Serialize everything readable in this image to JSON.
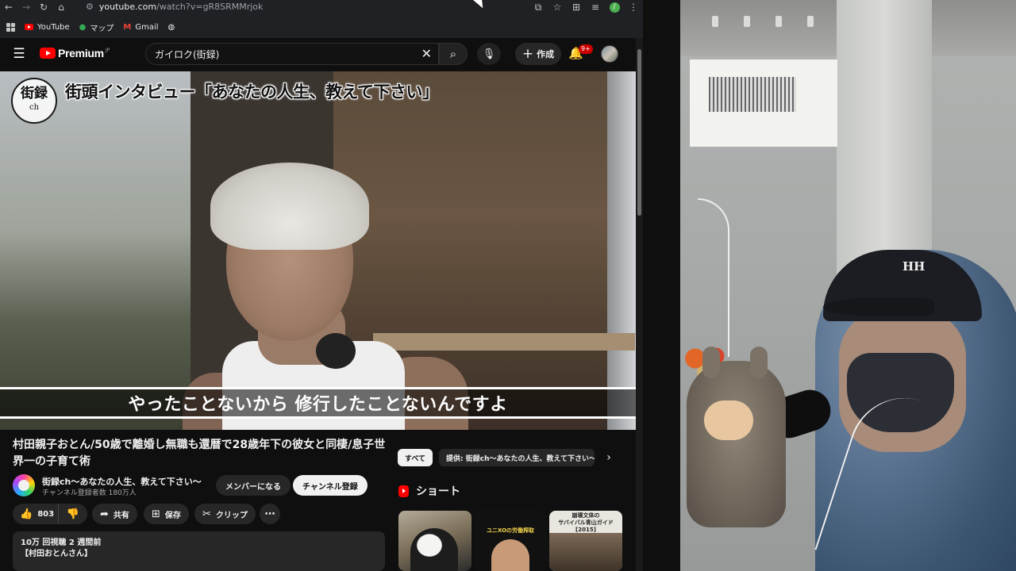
{
  "browser": {
    "url_host": "youtube.com",
    "url_path": "/watch?v=gR8SRMMrjok",
    "bookmarks": [
      {
        "label": "YouTube"
      },
      {
        "label": "マップ"
      },
      {
        "label": "Gmail"
      }
    ],
    "profile_initial": "/"
  },
  "yt_header": {
    "logo_text": "Premium",
    "logo_region": "JP",
    "search_value": "ガイロク(街録)",
    "create_label": "作成",
    "notification_badge": "9+"
  },
  "player": {
    "channel_logo_main": "街録",
    "channel_logo_sub": "ch",
    "overlay_title": "街頭インタビュー「あなたの人生、教えて下さい」",
    "subtitle": "やったことないから 修行したことないんですよ"
  },
  "video": {
    "title": "村田親子おとん/50歳で離婚し無職も還暦で28歳年下の彼女と同棲/息子世界一の子育て術",
    "channel_name": "街録ch〜あなたの人生、教えて下さい〜",
    "channel_subs": "チャンネル登録者数 180万人",
    "member_label": "メンバーになる",
    "subscribe_label": "チャンネル登録",
    "like_count": "803",
    "share_label": "共有",
    "save_label": "保存",
    "clip_label": "クリップ",
    "description_line1": "10万 回視聴  2 週間前",
    "description_line2": "【村田おとんさん】"
  },
  "related": {
    "chip_all": "すべて",
    "chip_provided": "提供: 街録ch〜あなたの人生、教えて下さい〜",
    "shorts_label": "ショート",
    "shorts": [
      {
        "caption": ""
      },
      {
        "caption": "ユニXOの労働搾取"
      },
      {
        "caption": "崩壊文体の\nサバイバル青山ガイド\n[2015]"
      }
    ]
  },
  "webcam": {
    "cap_logo": "HH"
  },
  "colors": {
    "yt_red": "#ff0000",
    "background": "#0f0f0f",
    "chip_bg": "#272727",
    "text_primary": "#f1f1f1",
    "text_secondary": "#aaaaaa"
  }
}
